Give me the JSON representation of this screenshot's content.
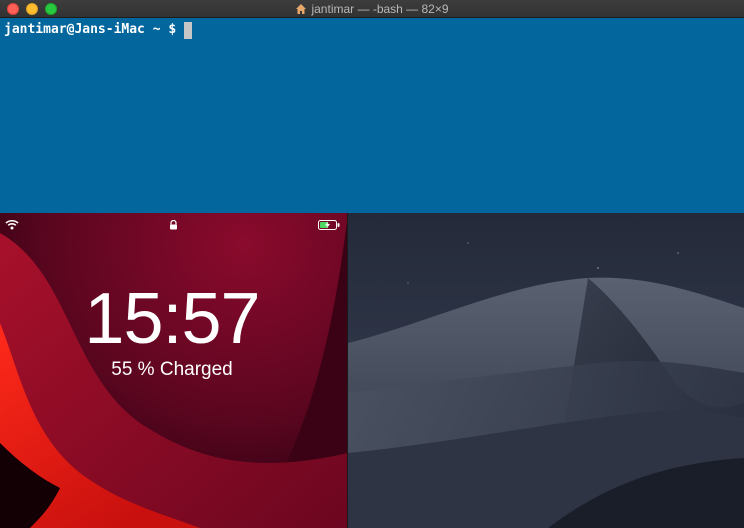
{
  "window": {
    "title": "jantimar — -bash — 82×9",
    "icon": "home-icon"
  },
  "terminal": {
    "prompt": "jantimar@Jans-iMac ~ $",
    "background": "#03679e"
  },
  "ipad": {
    "time": "15:57",
    "charge_status": "55 % Charged",
    "battery_level": 0.55,
    "status_icons": [
      "wifi-icon",
      "lock-icon",
      "battery-charging-icon"
    ]
  },
  "desktop": {
    "wallpaper": "dunes-night"
  }
}
